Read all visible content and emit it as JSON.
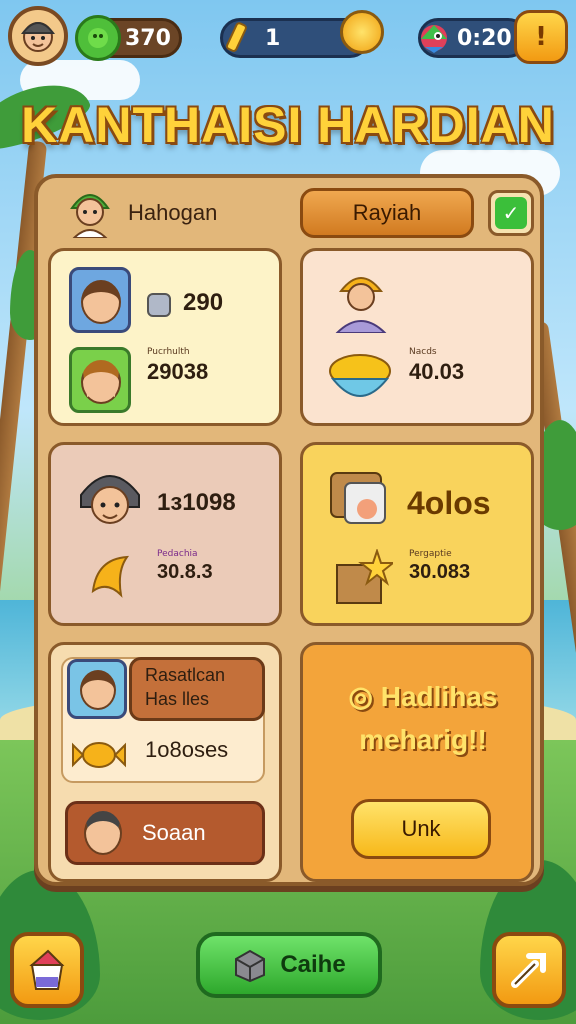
{
  "topbar": {
    "coins": "370",
    "tickets": "1",
    "timer": "0:20",
    "pause_symbol": "!"
  },
  "title": "KANTHAISI HARDIAN",
  "header": {
    "name": "Hahogan",
    "button_label": "Rayiah",
    "check_symbol": "✓"
  },
  "cards": {
    "c1": {
      "value1": "290",
      "caption": "Pucrhulth",
      "value2": "29038"
    },
    "c2": {
      "caption": "Nacds",
      "value": "40.03"
    },
    "c3": {
      "value1": "1з1098",
      "caption": "Pedachia",
      "value2": "30.8.3"
    },
    "c4": {
      "value1": "4olos",
      "caption": "Pergaptie",
      "value2": "30.083"
    },
    "c5": {
      "label1": "Rasatlcan",
      "label2": "Has lles",
      "value": "1o8oses",
      "button": "Soaan"
    },
    "c6": {
      "line1": "Hadlihas",
      "line2": "meharig!!",
      "button": "Unk"
    }
  },
  "bottom": {
    "cache_label": "Caihe"
  },
  "icons": [
    "avatar",
    "gem-icon",
    "pencil-icon",
    "coin-icon",
    "parrot-icon",
    "pause-icon",
    "check-icon",
    "robot-icon",
    "banana-icon",
    "crate-icon",
    "star-icon",
    "shop-icon",
    "tools-icon",
    "box-icon"
  ]
}
